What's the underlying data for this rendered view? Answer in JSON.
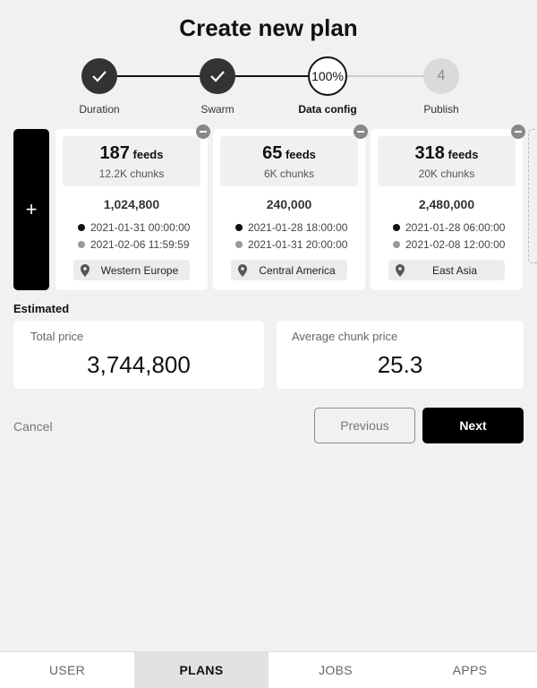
{
  "title": "Create new plan",
  "stepper": {
    "steps": [
      {
        "label": "Duration",
        "state": "done"
      },
      {
        "label": "Swarm",
        "state": "done"
      },
      {
        "label": "Data config",
        "state": "active",
        "display": "100%"
      },
      {
        "label": "Publish",
        "state": "todo",
        "display": "4"
      }
    ]
  },
  "add_label": "+",
  "cards": [
    {
      "feeds_num": "187",
      "feeds_unit": "feeds",
      "chunks": "12.2K chunks",
      "total": "1,024,800",
      "start": "2021-01-31 00:00:00",
      "end": "2021-02-06 11:59:59",
      "location": "Western Europe"
    },
    {
      "feeds_num": "65",
      "feeds_unit": "feeds",
      "chunks": "6K chunks",
      "total": "240,000",
      "start": "2021-01-28 18:00:00",
      "end": "2021-01-31 20:00:00",
      "location": "Central America"
    },
    {
      "feeds_num": "318",
      "feeds_unit": "feeds",
      "chunks": "20K chunks",
      "total": "2,480,000",
      "start": "2021-01-28 06:00:00",
      "end": "2021-02-08 12:00:00",
      "location": "East Asia"
    }
  ],
  "estimated": {
    "label": "Estimated",
    "total_price_label": "Total price",
    "total_price": "3,744,800",
    "avg_label": "Average chunk price",
    "avg_value": "25.3"
  },
  "actions": {
    "cancel": "Cancel",
    "previous": "Previous",
    "next": "Next"
  },
  "nav": {
    "items": [
      "USER",
      "PLANS",
      "JOBS",
      "APPS"
    ],
    "active": "PLANS"
  },
  "colors": {
    "accent": "#000000",
    "done_step": "#333333",
    "todo_step": "#dadada"
  }
}
